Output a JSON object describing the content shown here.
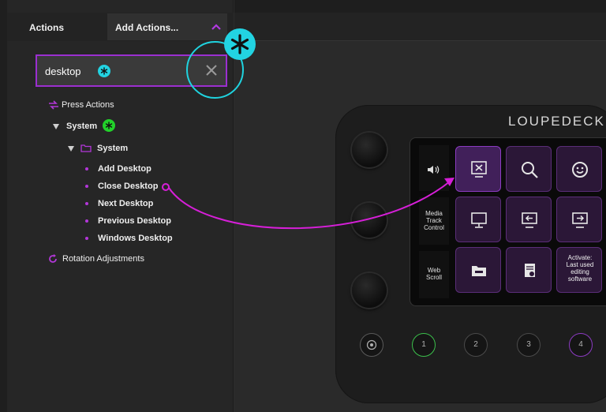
{
  "sidebar": {
    "tab_actions": "Actions",
    "add_actions": "Add Actions...",
    "search": {
      "value": "desktop",
      "placeholder": ""
    },
    "tree": {
      "press_actions": "Press Actions",
      "system_group": "System",
      "system_folder": "System",
      "items": [
        "Add Desktop",
        "Close Desktop",
        "Next Desktop",
        "Previous Desktop",
        "Windows Desktop"
      ],
      "rotation": "Rotation Adjustments"
    }
  },
  "device": {
    "brand": "LOUPEDECK",
    "left_labels": [
      "Media\nTrack\nControl",
      "Web\nScroll"
    ],
    "keys": [
      {
        "icon": "close-desktop-icon",
        "label": ""
      },
      {
        "icon": "search-icon",
        "label": ""
      },
      {
        "icon": "smiley-icon",
        "label": ""
      },
      {
        "icon": "monitor-icon",
        "label": ""
      },
      {
        "icon": "previous-desktop-icon",
        "label": ""
      },
      {
        "icon": "next-desktop-icon",
        "label": ""
      },
      {
        "icon": "folder-icon",
        "label": ""
      },
      {
        "icon": "notes-icon",
        "label": ""
      },
      {
        "icon": "",
        "label": "Activate:\nLast used\nediting\nsoftware"
      }
    ],
    "bottom_buttons": [
      "",
      "1",
      "2",
      "3",
      "4"
    ]
  },
  "colors": {
    "accent_purple": "#9b2fd0",
    "annotation_cyan": "#22d3e2",
    "annotation_green": "#22d22a",
    "annotation_magenta": "#d61fd8"
  }
}
